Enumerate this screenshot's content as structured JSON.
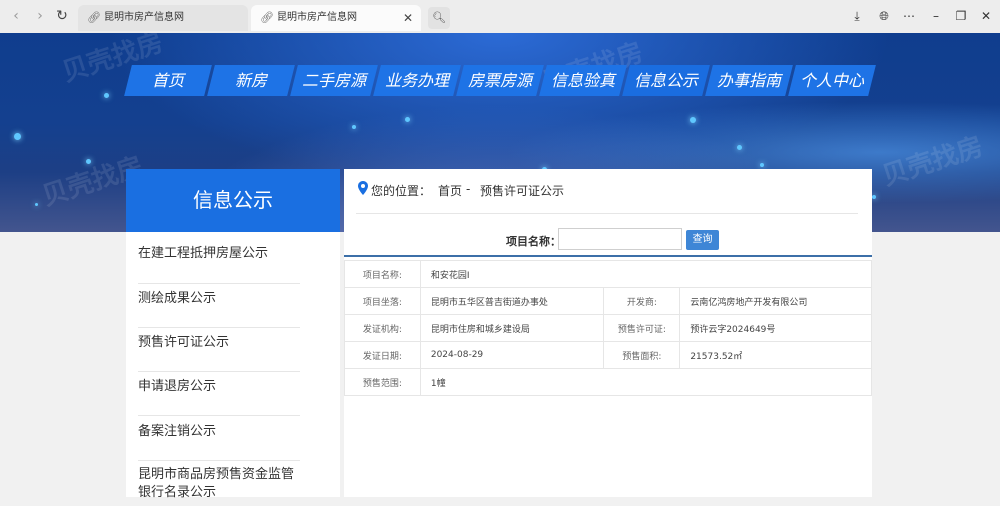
{
  "browser": {
    "tabs": [
      {
        "title": "昆明市房产信息网",
        "icon": "link-icon"
      },
      {
        "title": "昆明市房产信息网",
        "icon": "link-icon",
        "close": "✕"
      }
    ]
  },
  "banner": {
    "watermarks": [
      "贝壳找房",
      "贝壳找房",
      "贝壳找房",
      "贝壳找房"
    ],
    "menu": [
      "首页",
      "新房",
      "二手房源",
      "业务办理",
      "房票房源",
      "信息验真",
      "信息公示",
      "办事指南",
      "个人中心"
    ]
  },
  "sidebar": {
    "title": "信息公示",
    "items": [
      "在建工程抵押房屋公示",
      "测绘成果公示",
      "预售许可证公示",
      "申请退房公示",
      "备案注销公示",
      "昆明市商品房预售资金监管银行名录公示"
    ]
  },
  "main": {
    "location_label": "您的位置：",
    "breadcrumb_home": "首页",
    "breadcrumb_sep": "-",
    "breadcrumb_current": "预售许可证公示",
    "search_label": "项目名称：",
    "search_value": "",
    "search_button": "查询",
    "table": {
      "project_name_k": "项目名称:",
      "project_name_v": "和安花园I",
      "location_k": "项目坐落:",
      "location_v": "昆明市五华区普吉街道办事处",
      "developer_k": "开发商:",
      "developer_v": "云南亿鸿房地产开发有限公司",
      "issuer_k": "发证机构:",
      "issuer_v": "昆明市住房和城乡建设局",
      "permit_k": "预售许可证:",
      "permit_v": "预许云字2024649号",
      "date_k": "发证日期:",
      "date_v": "2024-08-29",
      "area_k": "预售面积:",
      "area_v": "21573.52㎡",
      "scope_k": "预售范围:",
      "scope_v": "1幢"
    }
  },
  "colors": {
    "accent": "#1a6fe1",
    "menu": "#1e73e6",
    "button": "#3e86d6"
  }
}
